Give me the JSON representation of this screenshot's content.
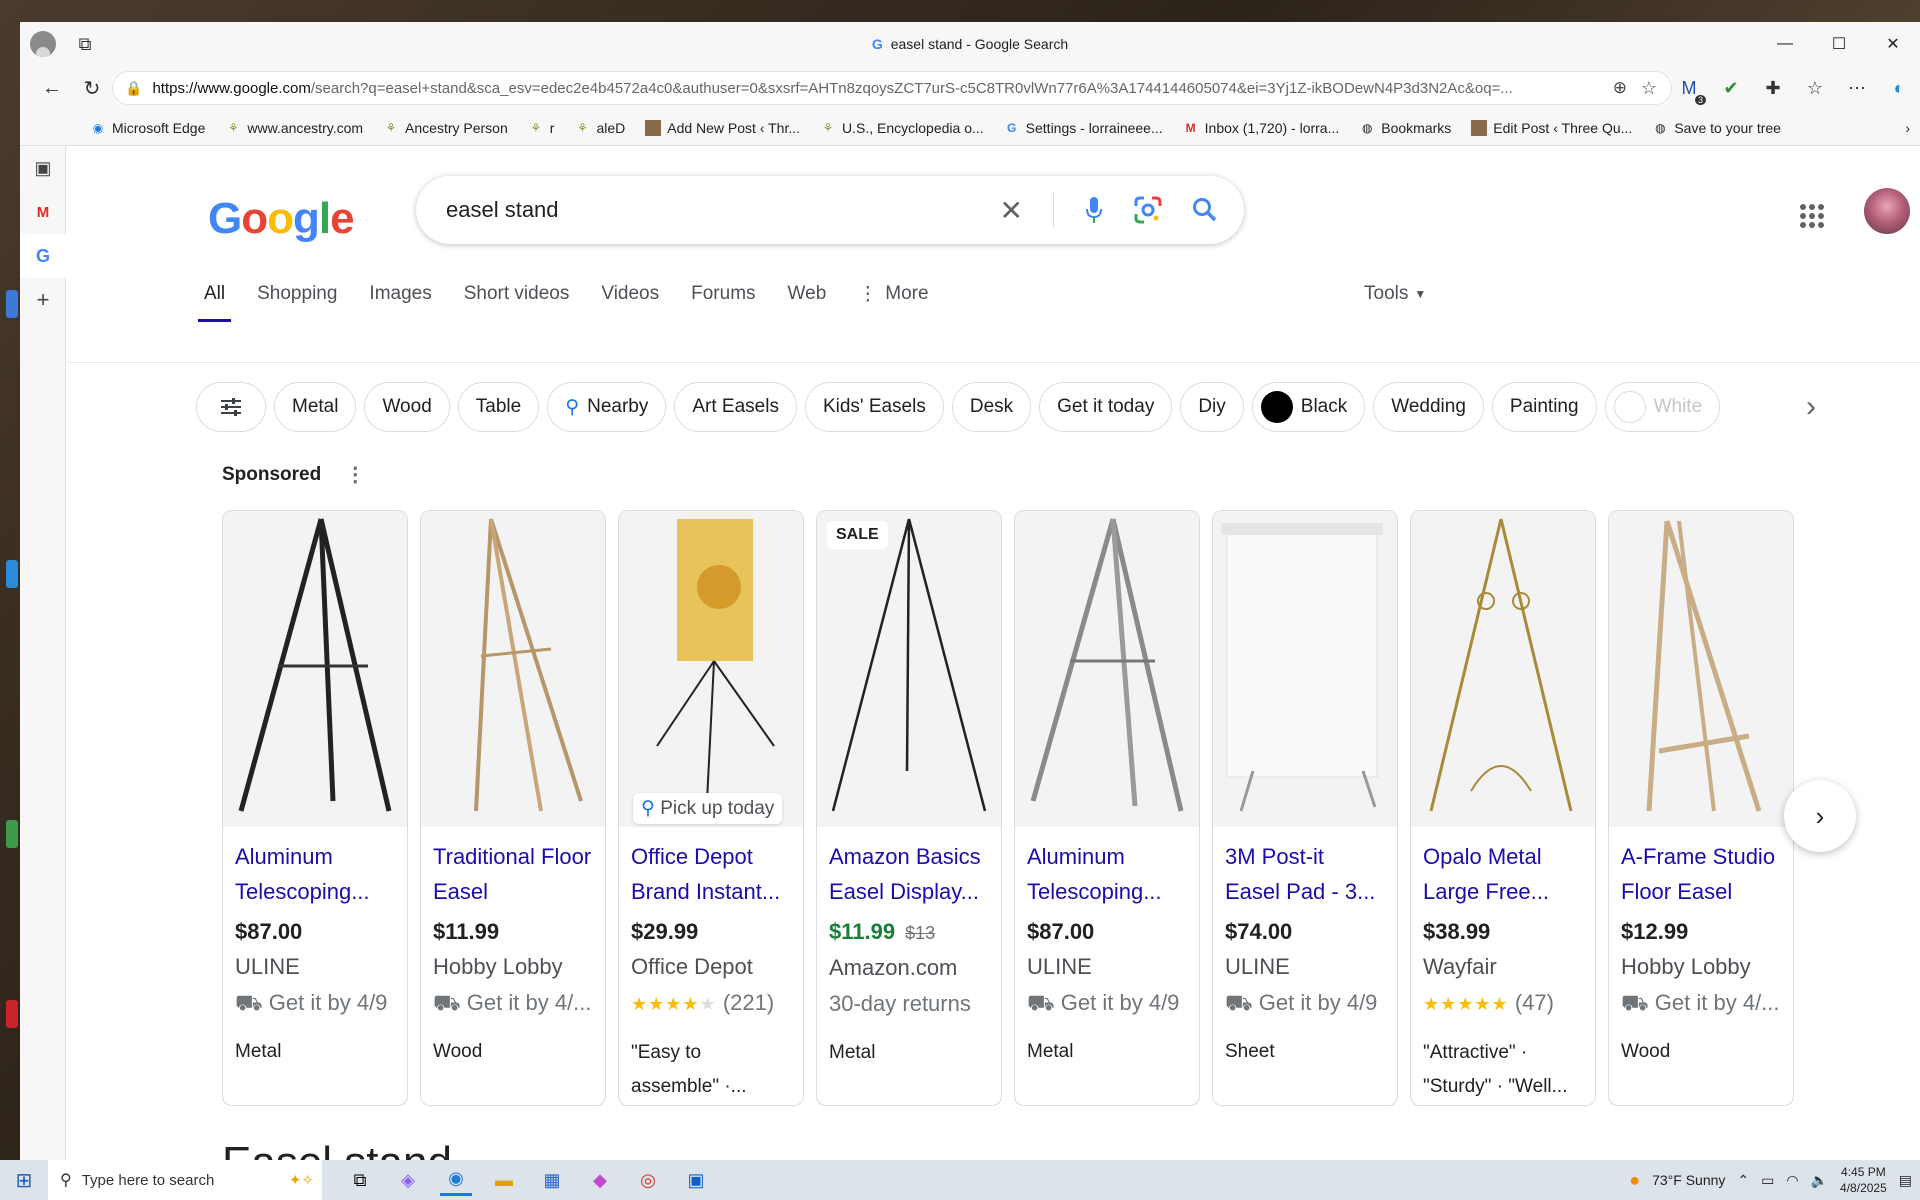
{
  "window": {
    "title": "easel stand - Google Search",
    "controls": [
      "—",
      "☐",
      "✕"
    ]
  },
  "address": {
    "url_domain": "https://www.google.com",
    "url_rest": "/search?q=easel+stand&sca_esv=edec2e4b4572a4c0&authuser=0&sxsrf=AHTn8zqoysZCT7urS-c5C8TR0vlWn77r6A%3A1744144605074&ei=3Yj1Z-ikBODewN4P3d3N2Ac&oq=...",
    "badge_count": "3"
  },
  "bookmarks": [
    {
      "label": "Microsoft Edge",
      "icon": "edge-icon"
    },
    {
      "label": "www.ancestry.com",
      "icon": "ancestry-leaf-icon"
    },
    {
      "label": "Ancestry Person",
      "icon": "ancestry-leaf-icon"
    },
    {
      "label": "r",
      "icon": "ancestry-leaf-icon"
    },
    {
      "label": "aleD",
      "icon": "ancestry-leaf-icon"
    },
    {
      "label": "Add New Post ‹ Thr...",
      "icon": "thumbnail-icon"
    },
    {
      "label": "U.S., Encyclopedia o...",
      "icon": "ancestry-leaf-icon"
    },
    {
      "label": "Settings - lorraineee...",
      "icon": "google-icon"
    },
    {
      "label": "Inbox (1,720) - lorra...",
      "icon": "gmail-icon"
    },
    {
      "label": "Bookmarks",
      "icon": "globe-icon"
    },
    {
      "label": "Edit Post ‹ Three Qu...",
      "icon": "thumbnail-icon"
    },
    {
      "label": "Save to your tree",
      "icon": "globe-icon"
    }
  ],
  "search": {
    "logo": "Google",
    "query": "easel stand",
    "tabs": [
      "All",
      "Shopping",
      "Images",
      "Short videos",
      "Videos",
      "Forums",
      "Web",
      "More"
    ],
    "tools_label": "Tools"
  },
  "chips": [
    "Metal",
    "Wood",
    "Table",
    "Nearby",
    "Art Easels",
    "Kids' Easels",
    "Desk",
    "Get it today",
    "Diy",
    "Black",
    "Wedding",
    "Painting",
    "White"
  ],
  "sponsored_label": "Sponsored",
  "products": [
    {
      "title": "Aluminum Telescoping...",
      "price": "$87.00",
      "old_price": "",
      "store": "ULINE",
      "extra": "Get it by 4/9",
      "extra_icon": "truck-icon",
      "tag": "Metal",
      "badge": "",
      "overlay": ""
    },
    {
      "title": "Traditional Floor Easel",
      "price": "$11.99",
      "old_price": "",
      "store": "Hobby Lobby",
      "extra": "Get it by 4/...",
      "extra_icon": "truck-icon",
      "tag": "Wood",
      "badge": "",
      "overlay": ""
    },
    {
      "title": "Office Depot Brand Instant...",
      "price": "$29.99",
      "old_price": "",
      "store": "Office Depot",
      "extra": "(221)",
      "rating": 4,
      "extra_icon": "stars",
      "tag": "\"Easy to assemble\" ·...",
      "badge": "",
      "overlay": "Pick up today"
    },
    {
      "title": "Amazon Basics Easel Display...",
      "price": "$11.99",
      "old_price": "$13",
      "store": "Amazon.com",
      "extra": "30-day returns",
      "extra_icon": "",
      "tag": "Metal",
      "badge": "SALE",
      "overlay": "",
      "price_green": true
    },
    {
      "title": "Aluminum Telescoping...",
      "price": "$87.00",
      "old_price": "",
      "store": "ULINE",
      "extra": "Get it by 4/9",
      "extra_icon": "truck-icon",
      "tag": "Metal",
      "badge": "",
      "overlay": ""
    },
    {
      "title": "3M Post-it Easel Pad - 3...",
      "price": "$74.00",
      "old_price": "",
      "store": "ULINE",
      "extra": "Get it by 4/9",
      "extra_icon": "truck-icon",
      "tag": "Sheet",
      "badge": "",
      "overlay": ""
    },
    {
      "title": "Opalo Metal Large Free...",
      "price": "$38.99",
      "old_price": "",
      "store": "Wayfair",
      "extra": "(47)",
      "rating": 5,
      "extra_icon": "stars",
      "tag": "\"Attractive\" · \"Sturdy\" · \"Well...",
      "badge": "",
      "overlay": ""
    },
    {
      "title": "A-Frame Studio Floor Easel",
      "price": "$12.99",
      "old_price": "",
      "store": "Hobby Lobby",
      "extra": "Get it by 4/...",
      "extra_icon": "truck-icon",
      "tag": "Wood",
      "badge": "",
      "overlay": ""
    }
  ],
  "next_heading": "Easel stand",
  "taskbar": {
    "search_placeholder": "Type here to search",
    "weather": "73°F  Sunny",
    "time": "4:45 PM",
    "date": "4/8/2025"
  },
  "colors": {
    "link": "#1a0dab",
    "price_sale": "#188038",
    "star": "#fbbc04"
  }
}
